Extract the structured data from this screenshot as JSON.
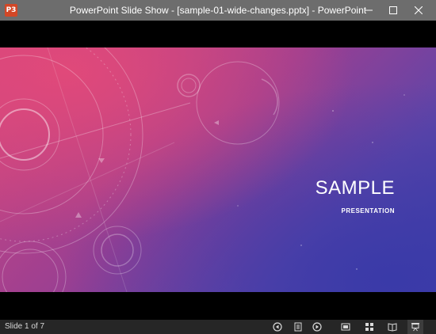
{
  "window": {
    "title": "PowerPoint Slide Show - [sample-01-wide-changes.pptx] - PowerPoint",
    "app_icon_text": "P3"
  },
  "slide": {
    "title": "SAMPLE",
    "subtitle": "PRESENTATION"
  },
  "status": {
    "slide_indicator": "Slide 1 of 7"
  },
  "icons": {
    "minimize": "minimize-icon",
    "maximize": "maximize-icon",
    "close": "close-icon",
    "previous": "previous-icon",
    "slide_list": "slide-list-icon",
    "next": "next-icon",
    "normal_view": "normal-view-icon",
    "slide_sorter": "slide-sorter-icon",
    "reading_view": "reading-view-icon",
    "slide_show": "slide-show-icon"
  },
  "colors": {
    "titlebar": "#6d6d6d",
    "statusbar": "#262626",
    "slide_pink": "#d3477e",
    "slide_blue": "#3f3fa6",
    "app_icon": "#d24726"
  }
}
